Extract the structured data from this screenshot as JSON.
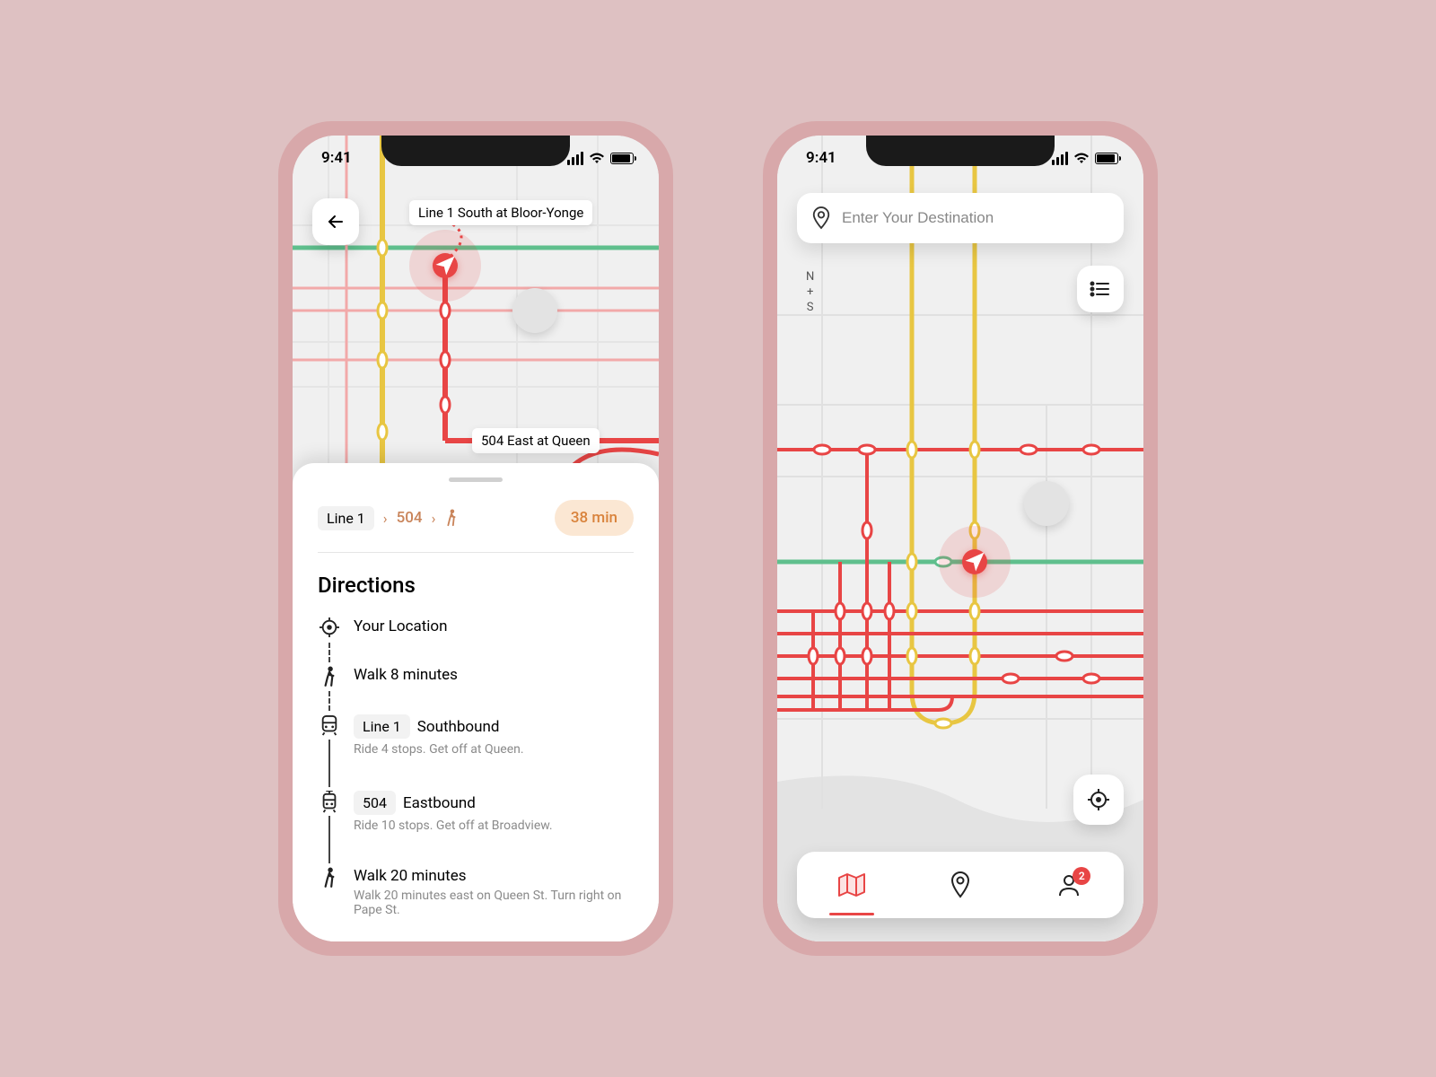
{
  "status": {
    "time": "9:41"
  },
  "left": {
    "callout_top": "Line 1 South at Bloor-Yonge",
    "callout_bottom": "504 East at Queen",
    "crumbs": {
      "line": "Line 1",
      "route": "504"
    },
    "duration": "38 min",
    "directions_title": "Directions",
    "steps": [
      {
        "icon": "target",
        "title": "Your Location"
      },
      {
        "icon": "walk",
        "title": "Walk 8 minutes"
      },
      {
        "icon": "subway",
        "chip": "Line 1",
        "direction": "Southbound",
        "sub": "Ride 4 stops. Get off at Queen."
      },
      {
        "icon": "tram",
        "chip": "504",
        "direction": "Eastbound",
        "sub": "Ride 10 stops. Get off at Broadview."
      },
      {
        "icon": "walk",
        "title": "Walk 20 minutes",
        "sub": "Walk 20 minutes east on Queen St. Turn right on Pape St."
      }
    ]
  },
  "right": {
    "search_placeholder": "Enter Your Destination",
    "compass": {
      "n": "N",
      "s": "S"
    },
    "badge_count": "2"
  },
  "colors": {
    "red": "#E84545",
    "yellow": "#E8C642",
    "green": "#5FBF8D",
    "pink": "#F2A9A9"
  }
}
